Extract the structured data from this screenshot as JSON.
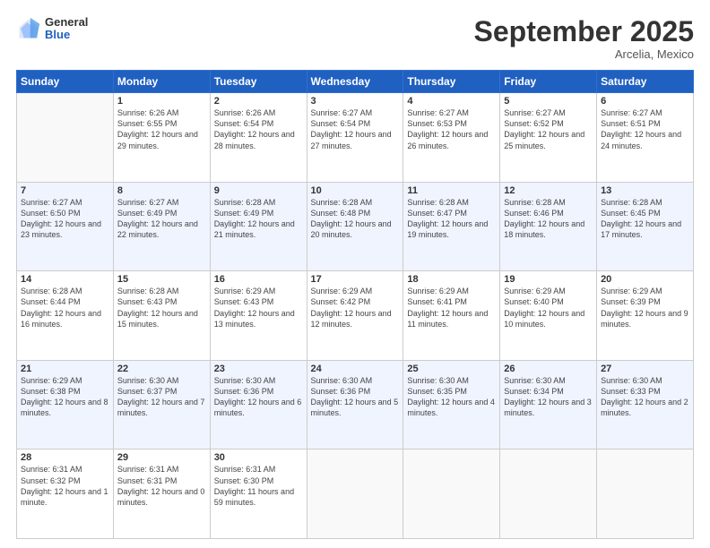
{
  "header": {
    "logo_general": "General",
    "logo_blue": "Blue",
    "month": "September 2025",
    "location": "Arcelia, Mexico"
  },
  "weekdays": [
    "Sunday",
    "Monday",
    "Tuesday",
    "Wednesday",
    "Thursday",
    "Friday",
    "Saturday"
  ],
  "weeks": [
    [
      {
        "day": "",
        "sunrise": "",
        "sunset": "",
        "daylight": "",
        "empty": true
      },
      {
        "day": "1",
        "sunrise": "Sunrise: 6:26 AM",
        "sunset": "Sunset: 6:55 PM",
        "daylight": "Daylight: 12 hours and 29 minutes."
      },
      {
        "day": "2",
        "sunrise": "Sunrise: 6:26 AM",
        "sunset": "Sunset: 6:54 PM",
        "daylight": "Daylight: 12 hours and 28 minutes."
      },
      {
        "day": "3",
        "sunrise": "Sunrise: 6:27 AM",
        "sunset": "Sunset: 6:54 PM",
        "daylight": "Daylight: 12 hours and 27 minutes."
      },
      {
        "day": "4",
        "sunrise": "Sunrise: 6:27 AM",
        "sunset": "Sunset: 6:53 PM",
        "daylight": "Daylight: 12 hours and 26 minutes."
      },
      {
        "day": "5",
        "sunrise": "Sunrise: 6:27 AM",
        "sunset": "Sunset: 6:52 PM",
        "daylight": "Daylight: 12 hours and 25 minutes."
      },
      {
        "day": "6",
        "sunrise": "Sunrise: 6:27 AM",
        "sunset": "Sunset: 6:51 PM",
        "daylight": "Daylight: 12 hours and 24 minutes."
      }
    ],
    [
      {
        "day": "7",
        "sunrise": "Sunrise: 6:27 AM",
        "sunset": "Sunset: 6:50 PM",
        "daylight": "Daylight: 12 hours and 23 minutes."
      },
      {
        "day": "8",
        "sunrise": "Sunrise: 6:27 AM",
        "sunset": "Sunset: 6:49 PM",
        "daylight": "Daylight: 12 hours and 22 minutes."
      },
      {
        "day": "9",
        "sunrise": "Sunrise: 6:28 AM",
        "sunset": "Sunset: 6:49 PM",
        "daylight": "Daylight: 12 hours and 21 minutes."
      },
      {
        "day": "10",
        "sunrise": "Sunrise: 6:28 AM",
        "sunset": "Sunset: 6:48 PM",
        "daylight": "Daylight: 12 hours and 20 minutes."
      },
      {
        "day": "11",
        "sunrise": "Sunrise: 6:28 AM",
        "sunset": "Sunset: 6:47 PM",
        "daylight": "Daylight: 12 hours and 19 minutes."
      },
      {
        "day": "12",
        "sunrise": "Sunrise: 6:28 AM",
        "sunset": "Sunset: 6:46 PM",
        "daylight": "Daylight: 12 hours and 18 minutes."
      },
      {
        "day": "13",
        "sunrise": "Sunrise: 6:28 AM",
        "sunset": "Sunset: 6:45 PM",
        "daylight": "Daylight: 12 hours and 17 minutes."
      }
    ],
    [
      {
        "day": "14",
        "sunrise": "Sunrise: 6:28 AM",
        "sunset": "Sunset: 6:44 PM",
        "daylight": "Daylight: 12 hours and 16 minutes."
      },
      {
        "day": "15",
        "sunrise": "Sunrise: 6:28 AM",
        "sunset": "Sunset: 6:43 PM",
        "daylight": "Daylight: 12 hours and 15 minutes."
      },
      {
        "day": "16",
        "sunrise": "Sunrise: 6:29 AM",
        "sunset": "Sunset: 6:43 PM",
        "daylight": "Daylight: 12 hours and 13 minutes."
      },
      {
        "day": "17",
        "sunrise": "Sunrise: 6:29 AM",
        "sunset": "Sunset: 6:42 PM",
        "daylight": "Daylight: 12 hours and 12 minutes."
      },
      {
        "day": "18",
        "sunrise": "Sunrise: 6:29 AM",
        "sunset": "Sunset: 6:41 PM",
        "daylight": "Daylight: 12 hours and 11 minutes."
      },
      {
        "day": "19",
        "sunrise": "Sunrise: 6:29 AM",
        "sunset": "Sunset: 6:40 PM",
        "daylight": "Daylight: 12 hours and 10 minutes."
      },
      {
        "day": "20",
        "sunrise": "Sunrise: 6:29 AM",
        "sunset": "Sunset: 6:39 PM",
        "daylight": "Daylight: 12 hours and 9 minutes."
      }
    ],
    [
      {
        "day": "21",
        "sunrise": "Sunrise: 6:29 AM",
        "sunset": "Sunset: 6:38 PM",
        "daylight": "Daylight: 12 hours and 8 minutes."
      },
      {
        "day": "22",
        "sunrise": "Sunrise: 6:30 AM",
        "sunset": "Sunset: 6:37 PM",
        "daylight": "Daylight: 12 hours and 7 minutes."
      },
      {
        "day": "23",
        "sunrise": "Sunrise: 6:30 AM",
        "sunset": "Sunset: 6:36 PM",
        "daylight": "Daylight: 12 hours and 6 minutes."
      },
      {
        "day": "24",
        "sunrise": "Sunrise: 6:30 AM",
        "sunset": "Sunset: 6:36 PM",
        "daylight": "Daylight: 12 hours and 5 minutes."
      },
      {
        "day": "25",
        "sunrise": "Sunrise: 6:30 AM",
        "sunset": "Sunset: 6:35 PM",
        "daylight": "Daylight: 12 hours and 4 minutes."
      },
      {
        "day": "26",
        "sunrise": "Sunrise: 6:30 AM",
        "sunset": "Sunset: 6:34 PM",
        "daylight": "Daylight: 12 hours and 3 minutes."
      },
      {
        "day": "27",
        "sunrise": "Sunrise: 6:30 AM",
        "sunset": "Sunset: 6:33 PM",
        "daylight": "Daylight: 12 hours and 2 minutes."
      }
    ],
    [
      {
        "day": "28",
        "sunrise": "Sunrise: 6:31 AM",
        "sunset": "Sunset: 6:32 PM",
        "daylight": "Daylight: 12 hours and 1 minute."
      },
      {
        "day": "29",
        "sunrise": "Sunrise: 6:31 AM",
        "sunset": "Sunset: 6:31 PM",
        "daylight": "Daylight: 12 hours and 0 minutes."
      },
      {
        "day": "30",
        "sunrise": "Sunrise: 6:31 AM",
        "sunset": "Sunset: 6:30 PM",
        "daylight": "Daylight: 11 hours and 59 minutes."
      },
      {
        "day": "",
        "sunrise": "",
        "sunset": "",
        "daylight": "",
        "empty": true
      },
      {
        "day": "",
        "sunrise": "",
        "sunset": "",
        "daylight": "",
        "empty": true
      },
      {
        "day": "",
        "sunrise": "",
        "sunset": "",
        "daylight": "",
        "empty": true
      },
      {
        "day": "",
        "sunrise": "",
        "sunset": "",
        "daylight": "",
        "empty": true
      }
    ]
  ]
}
